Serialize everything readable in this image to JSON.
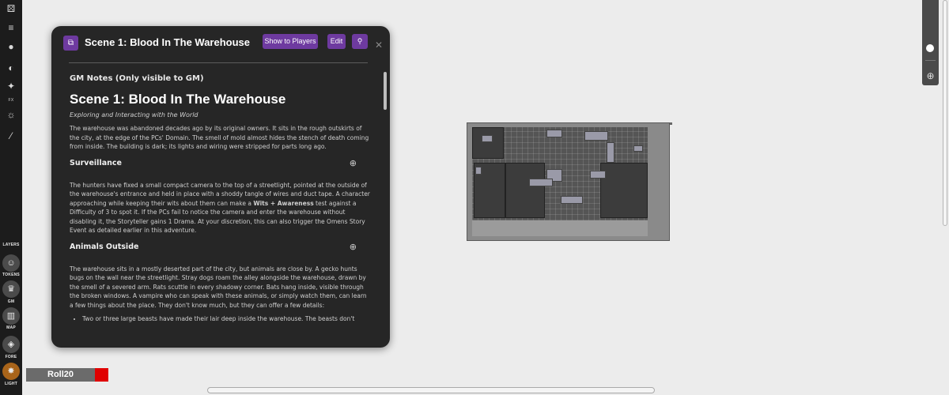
{
  "toolbar": {
    "icons": [
      "dice-icon",
      "draw-icon",
      "pin-icon",
      "fog-icon",
      "pointer-fx-icon",
      "light-icon",
      "magic-icon"
    ],
    "fx_label": "FX",
    "layers_label": "LAYERS",
    "layers": [
      {
        "label": "TOKENS",
        "icon": "tokens-icon"
      },
      {
        "label": "GM",
        "icon": "gm-crown-icon"
      },
      {
        "label": "MAP",
        "icon": "map-icon"
      },
      {
        "label": "FORE",
        "icon": "foreground-icon"
      },
      {
        "label": "LIGHT",
        "icon": "light-layer-icon",
        "active": true
      }
    ]
  },
  "handout": {
    "title": "Scene 1: Blood In The Warehouse",
    "buttons": {
      "show": "Show to Players",
      "edit": "Edit",
      "search": "search-icon"
    },
    "gm_notes_label": "GM Notes (Only visible to GM)",
    "heading": "Scene 1: Blood In The Warehouse",
    "subtitle": "Exploring and Interacting with the World",
    "intro": "The warehouse was abandoned decades ago by its original owners. It sits in the rough outskirts of the city, at the edge of the PCs' Domain. The smell of mold almost hides the stench of death coming from inside. The building is dark; its lights and wiring were stripped for parts long ago.",
    "sections": [
      {
        "title": "Surveillance",
        "text_a": "The hunters have fixed a small compact camera to the top of a streetlight, pointed at the outside of the warehouse's entrance and held in place with a shoddy tangle of wires and duct tape. A character approaching while keeping their wits about them can make a ",
        "bold": "Wits + Awareness",
        "text_b": " test against a Difficulty of 3 to spot it. If the PCs fail to notice the camera and enter the warehouse without disabling it, the Storyteller gains 1 Drama. At your discretion, this can also trigger the Omens Story Event as detailed earlier in this adventure."
      },
      {
        "title": "Animals Outside",
        "text": "The warehouse sits in a mostly deserted part of the city, but animals are close by. A gecko hunts bugs on the wall near the streetlight. Stray dogs roam the alley alongside the warehouse, drawn by the smell of a severed arm. Rats scuttle in every shadowy corner. Bats hang inside, visible through the broken windows. A vampire who can speak with these animals, or simply watch them, can learn a few things about the place. They don't know much, but they can offer a few details:",
        "bullets": [
          "Two or three large beasts have made their lair deep inside the warehouse. The beasts don't"
        ]
      }
    ]
  },
  "player": {
    "name": "Roll20",
    "color": "#e00000"
  }
}
